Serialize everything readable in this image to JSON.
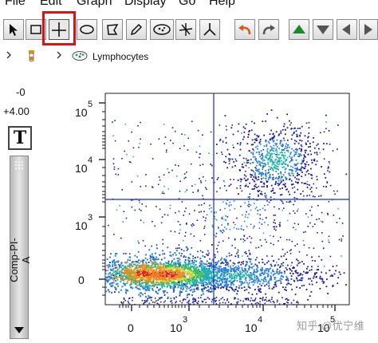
{
  "menubar": {
    "items": [
      {
        "label": "File"
      },
      {
        "label": "Edit"
      },
      {
        "label": "Graph"
      },
      {
        "label": "Display"
      },
      {
        "label": "Go"
      },
      {
        "label": "Help"
      }
    ]
  },
  "toolbar": {
    "tools": [
      {
        "icon": "arrow-pointer-icon"
      },
      {
        "icon": "rectangle-gate-icon"
      },
      {
        "icon": "quadrant-gate-icon",
        "selected": true
      },
      {
        "icon": "ellipse-gate-icon"
      },
      {
        "icon": "polygon-gate-icon"
      },
      {
        "icon": "pencil-icon"
      },
      {
        "icon": "auto-gate-icon"
      },
      {
        "icon": "spider-gate-icon"
      },
      {
        "icon": "tri-spider-icon"
      },
      {
        "icon": "undo-icon"
      },
      {
        "icon": "redo-icon"
      },
      {
        "icon": "up-arrow-icon"
      },
      {
        "icon": "down-arrow-icon"
      },
      {
        "icon": "left-arrow-icon"
      },
      {
        "icon": "right-arrow-icon"
      }
    ],
    "highlight_color": "#e01010"
  },
  "breadcrumb": {
    "population": "Lymphocytes"
  },
  "side_panel": {
    "value_top": "-0",
    "value_bottom": "+4.00",
    "text_tool": "T",
    "y_parameter": "Comp-PI-A"
  },
  "plot": {
    "y_tick_labels": [
      {
        "base": "10",
        "exp": "5"
      },
      {
        "base": "10",
        "exp": "4"
      },
      {
        "base": "10",
        "exp": "3"
      },
      {
        "base": "0",
        "exp": ""
      }
    ],
    "x_tick_labels": [
      {
        "base": "0",
        "exp": ""
      },
      {
        "base": "10",
        "exp": "3"
      },
      {
        "base": "10",
        "exp": "4"
      },
      {
        "base": "10",
        "exp": "5"
      }
    ],
    "quadrant_color": "#1a2fbf",
    "density_colors": [
      "#1a1aa0",
      "#2a7fd8",
      "#1fb5a8",
      "#39c048",
      "#d8d82a",
      "#f08a20",
      "#e02020"
    ]
  },
  "watermark": "知乎 @优宁维"
}
